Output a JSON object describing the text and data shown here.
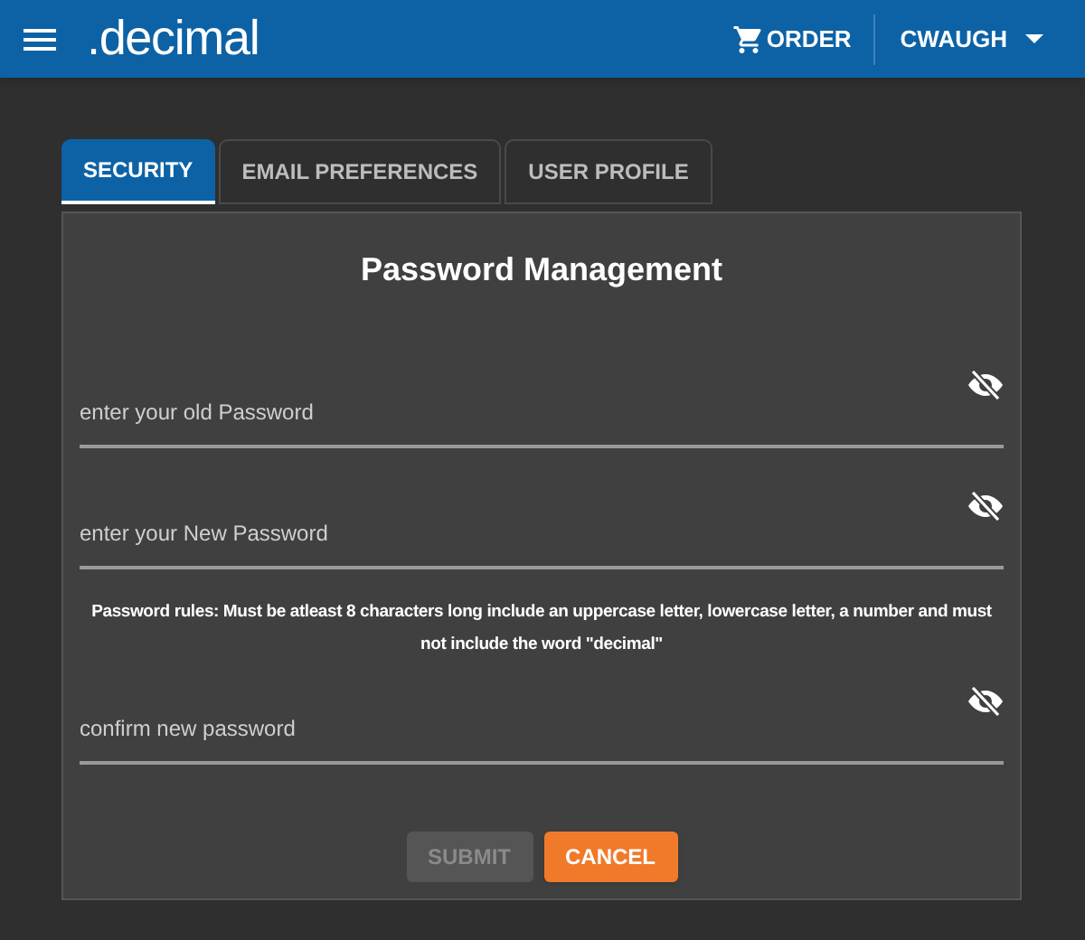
{
  "header": {
    "logo": ".decimal",
    "order": "ORDER",
    "user": "CWAUGH"
  },
  "tabs": [
    {
      "label": "SECURITY",
      "selected": true
    },
    {
      "label": "EMAIL PREFERENCES",
      "selected": false
    },
    {
      "label": "USER PROFILE",
      "selected": false
    }
  ],
  "panel": {
    "title": "Password Management",
    "items": [
      {
        "kind": "password",
        "placeholder": "enter your old Password"
      },
      {
        "kind": "password",
        "placeholder": "enter your New Password"
      },
      {
        "kind": "note",
        "text": "Password rules: Must be atleast 8 characters long include an uppercase letter, lowercase letter, a number and must not include the word \"decimal\""
      },
      {
        "kind": "password",
        "placeholder": "confirm new password"
      }
    ],
    "buttons": [
      {
        "kind": "submit",
        "label": "SUBMIT",
        "disabled": true
      },
      {
        "kind": "cancel",
        "label": "CANCEL",
        "disabled": false
      }
    ]
  }
}
